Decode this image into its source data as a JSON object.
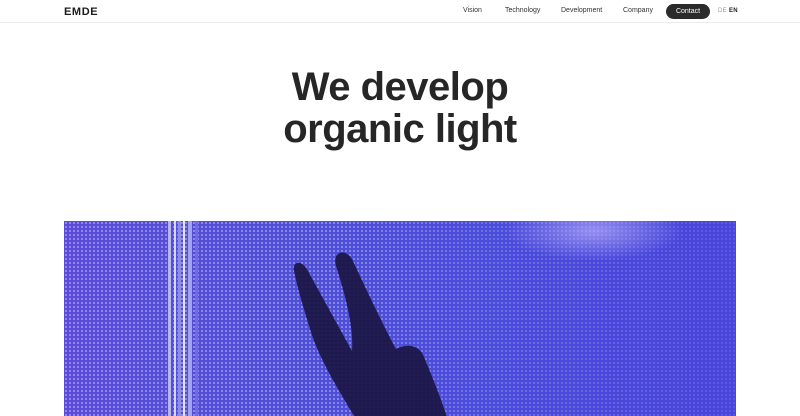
{
  "header": {
    "logo": "EMDE",
    "nav": [
      "Vision",
      "Technology",
      "Development",
      "Company"
    ],
    "contact_label": "Contact",
    "languages": [
      "DE",
      "EN"
    ],
    "active_language": "EN"
  },
  "hero": {
    "title_line1": "We develop",
    "title_line2": "organic light"
  },
  "colors": {
    "accent": "#2b2b2b",
    "image_blue": "#4f4fd6"
  }
}
